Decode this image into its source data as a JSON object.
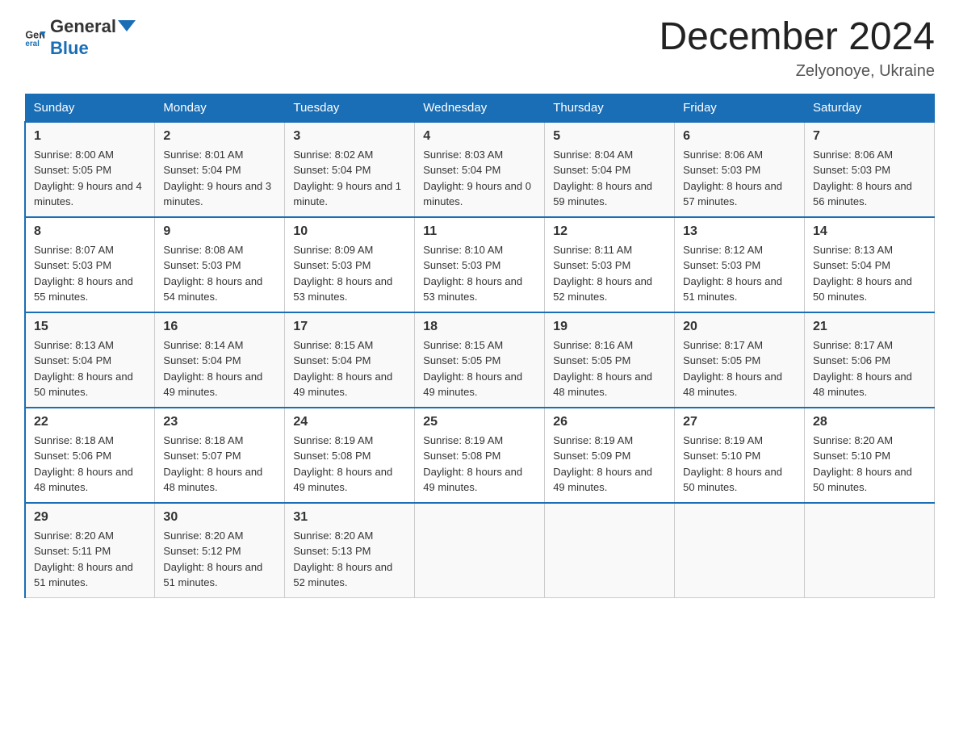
{
  "logo": {
    "text_general": "General",
    "text_blue": "Blue"
  },
  "title": "December 2024",
  "location": "Zelyonoye, Ukraine",
  "days_of_week": [
    "Sunday",
    "Monday",
    "Tuesday",
    "Wednesday",
    "Thursday",
    "Friday",
    "Saturday"
  ],
  "weeks": [
    [
      {
        "day": "1",
        "sunrise": "8:00 AM",
        "sunset": "5:05 PM",
        "daylight": "9 hours and 4 minutes."
      },
      {
        "day": "2",
        "sunrise": "8:01 AM",
        "sunset": "5:04 PM",
        "daylight": "9 hours and 3 minutes."
      },
      {
        "day": "3",
        "sunrise": "8:02 AM",
        "sunset": "5:04 PM",
        "daylight": "9 hours and 1 minute."
      },
      {
        "day": "4",
        "sunrise": "8:03 AM",
        "sunset": "5:04 PM",
        "daylight": "9 hours and 0 minutes."
      },
      {
        "day": "5",
        "sunrise": "8:04 AM",
        "sunset": "5:04 PM",
        "daylight": "8 hours and 59 minutes."
      },
      {
        "day": "6",
        "sunrise": "8:06 AM",
        "sunset": "5:03 PM",
        "daylight": "8 hours and 57 minutes."
      },
      {
        "day": "7",
        "sunrise": "8:06 AM",
        "sunset": "5:03 PM",
        "daylight": "8 hours and 56 minutes."
      }
    ],
    [
      {
        "day": "8",
        "sunrise": "8:07 AM",
        "sunset": "5:03 PM",
        "daylight": "8 hours and 55 minutes."
      },
      {
        "day": "9",
        "sunrise": "8:08 AM",
        "sunset": "5:03 PM",
        "daylight": "8 hours and 54 minutes."
      },
      {
        "day": "10",
        "sunrise": "8:09 AM",
        "sunset": "5:03 PM",
        "daylight": "8 hours and 53 minutes."
      },
      {
        "day": "11",
        "sunrise": "8:10 AM",
        "sunset": "5:03 PM",
        "daylight": "8 hours and 53 minutes."
      },
      {
        "day": "12",
        "sunrise": "8:11 AM",
        "sunset": "5:03 PM",
        "daylight": "8 hours and 52 minutes."
      },
      {
        "day": "13",
        "sunrise": "8:12 AM",
        "sunset": "5:03 PM",
        "daylight": "8 hours and 51 minutes."
      },
      {
        "day": "14",
        "sunrise": "8:13 AM",
        "sunset": "5:04 PM",
        "daylight": "8 hours and 50 minutes."
      }
    ],
    [
      {
        "day": "15",
        "sunrise": "8:13 AM",
        "sunset": "5:04 PM",
        "daylight": "8 hours and 50 minutes."
      },
      {
        "day": "16",
        "sunrise": "8:14 AM",
        "sunset": "5:04 PM",
        "daylight": "8 hours and 49 minutes."
      },
      {
        "day": "17",
        "sunrise": "8:15 AM",
        "sunset": "5:04 PM",
        "daylight": "8 hours and 49 minutes."
      },
      {
        "day": "18",
        "sunrise": "8:15 AM",
        "sunset": "5:05 PM",
        "daylight": "8 hours and 49 minutes."
      },
      {
        "day": "19",
        "sunrise": "8:16 AM",
        "sunset": "5:05 PM",
        "daylight": "8 hours and 48 minutes."
      },
      {
        "day": "20",
        "sunrise": "8:17 AM",
        "sunset": "5:05 PM",
        "daylight": "8 hours and 48 minutes."
      },
      {
        "day": "21",
        "sunrise": "8:17 AM",
        "sunset": "5:06 PM",
        "daylight": "8 hours and 48 minutes."
      }
    ],
    [
      {
        "day": "22",
        "sunrise": "8:18 AM",
        "sunset": "5:06 PM",
        "daylight": "8 hours and 48 minutes."
      },
      {
        "day": "23",
        "sunrise": "8:18 AM",
        "sunset": "5:07 PM",
        "daylight": "8 hours and 48 minutes."
      },
      {
        "day": "24",
        "sunrise": "8:19 AM",
        "sunset": "5:08 PM",
        "daylight": "8 hours and 49 minutes."
      },
      {
        "day": "25",
        "sunrise": "8:19 AM",
        "sunset": "5:08 PM",
        "daylight": "8 hours and 49 minutes."
      },
      {
        "day": "26",
        "sunrise": "8:19 AM",
        "sunset": "5:09 PM",
        "daylight": "8 hours and 49 minutes."
      },
      {
        "day": "27",
        "sunrise": "8:19 AM",
        "sunset": "5:10 PM",
        "daylight": "8 hours and 50 minutes."
      },
      {
        "day": "28",
        "sunrise": "8:20 AM",
        "sunset": "5:10 PM",
        "daylight": "8 hours and 50 minutes."
      }
    ],
    [
      {
        "day": "29",
        "sunrise": "8:20 AM",
        "sunset": "5:11 PM",
        "daylight": "8 hours and 51 minutes."
      },
      {
        "day": "30",
        "sunrise": "8:20 AM",
        "sunset": "5:12 PM",
        "daylight": "8 hours and 51 minutes."
      },
      {
        "day": "31",
        "sunrise": "8:20 AM",
        "sunset": "5:13 PM",
        "daylight": "8 hours and 52 minutes."
      },
      null,
      null,
      null,
      null
    ]
  ]
}
